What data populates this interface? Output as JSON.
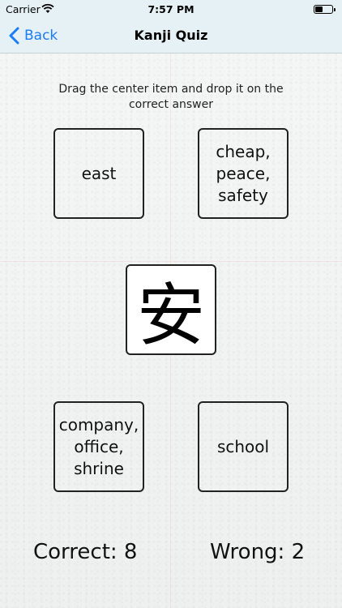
{
  "status_bar": {
    "carrier": "Carrier",
    "time": "7:57 PM"
  },
  "nav": {
    "back_label": "Back",
    "title": "Kanji Quiz"
  },
  "instruction": "Drag the center item and drop it on the correct answer",
  "answers": [
    {
      "label_lines": [
        "east"
      ]
    },
    {
      "label_lines": [
        "cheap,",
        "peace,",
        "safety"
      ]
    },
    {
      "label_lines": [
        "company,",
        "office,",
        "shrine"
      ]
    },
    {
      "label_lines": [
        "school"
      ]
    }
  ],
  "kanji": "安",
  "score": {
    "correct": "Correct: 8",
    "wrong": "Wrong: 2"
  },
  "colors": {
    "accent": "#1a7cf6",
    "nav_background": "#e6f1f6"
  }
}
